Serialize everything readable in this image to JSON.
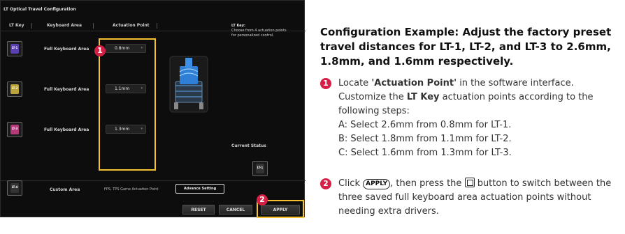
{
  "software": {
    "section_title": "LT Optical Travel Configuration",
    "headers": {
      "lt_key": "LT Key",
      "keyboard_area": "Keyboard Area",
      "actuation_point": "Actuation Point"
    },
    "lt_key_info_title": "LT Key:",
    "lt_key_info_text": "Choose from 4 actuation points for personalized control.",
    "current_status": "Current Status",
    "rows": [
      {
        "key": "LT-1",
        "area": "Full Keyboard Area",
        "value": "0.8mm",
        "key_color": "#5a3fb0"
      },
      {
        "key": "LT-2",
        "area": "Full Keyboard Area",
        "value": "1.1mm",
        "key_color": "#b9a33a"
      },
      {
        "key": "LT-3",
        "area": "Full Keyboard Area",
        "value": "1.3mm",
        "key_color": "#b43a7a"
      }
    ],
    "custom": {
      "key": "LT-4",
      "area": "Custom Area",
      "desc": "FPS, TPS Game Actuation Point",
      "advanced_label": "Advance Setting"
    },
    "buttons": {
      "reset": "RESET",
      "cancel": "CANCEL",
      "apply": "APPLY"
    },
    "badge1": "1",
    "badge2": "2",
    "status_key": "LT-1"
  },
  "doc": {
    "title": "Configuration Example: Adjust the factory preset travel distances for LT-1, LT-2, and LT-3 to 2.6mm, 1.8mm, and 1.6mm respectively.",
    "step1": {
      "num": "1",
      "pre": "Locate ",
      "bold1": "'Actuation Point'",
      "mid": " in the software interface. Customize the ",
      "bold2": "LT Key",
      "post": " actuation points according to the following steps:",
      "a": "A: Select 2.6mm from 0.8mm for LT-1.",
      "b": "B: Select 1.8mm from 1.1mm for LT-2.",
      "c": "C: Select 1.6mm from 1.3mm for LT-3."
    },
    "step2": {
      "num": "2",
      "pre": "Click ",
      "key": "APPLY",
      "mid": ", then press the ",
      "post": " button to switch between the three saved full keyboard area actuation points without needing extra drivers."
    }
  }
}
